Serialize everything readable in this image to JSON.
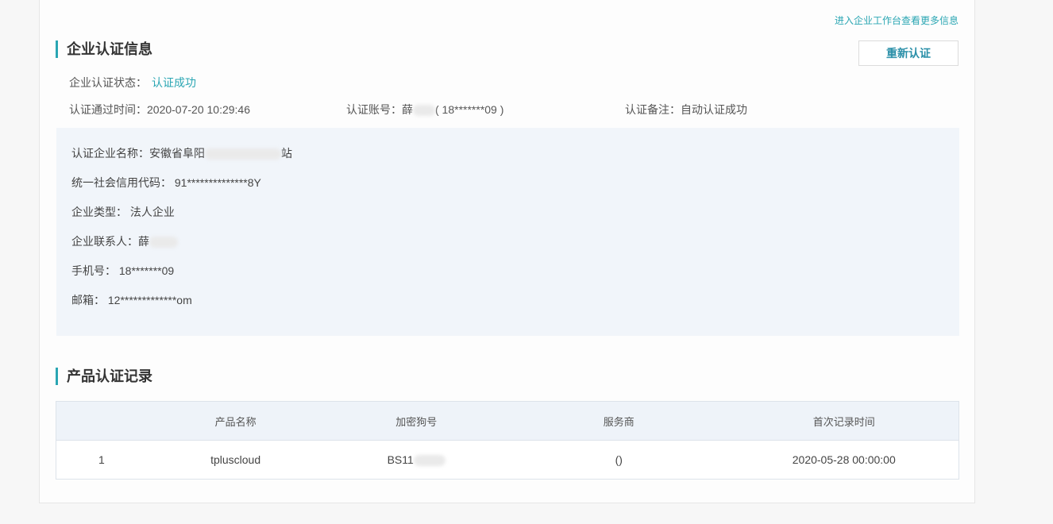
{
  "top_link": "进入企业工作台查看更多信息",
  "enterprise_section": {
    "title": "企业认证信息",
    "reauth_button": "重新认证",
    "status_label": "企业认证状态：",
    "status_value": "认证成功",
    "pass_time_label": "认证通过时间：",
    "pass_time_value": "2020-07-20 10:29:46",
    "account_label": "认证账号：",
    "account_value_prefix": "薛",
    "account_value_suffix": "( 18*******09 )",
    "remark_label": "认证备注：",
    "remark_value": "自动认证成功"
  },
  "details": {
    "company_name_label": "认证企业名称：",
    "company_name_prefix": "安徽省阜阳",
    "company_name_suffix": "站",
    "credit_code_label": "统一社会信用代码：",
    "credit_code_value": "91**************8Y",
    "type_label": "企业类型：",
    "type_value": "法人企业",
    "contact_label": "企业联系人：",
    "contact_value_prefix": "薛",
    "phone_label": "手机号：",
    "phone_value": "18*******09",
    "email_label": "邮箱：",
    "email_value": "12*************om"
  },
  "product_section": {
    "title": "产品认证记录",
    "columns": [
      "",
      "产品名称",
      "加密狗号",
      "服务商",
      "首次记录时间"
    ],
    "rows": [
      {
        "index": "1",
        "product_name": "tpluscloud",
        "dongle_prefix": "BS11",
        "provider": "()",
        "first_time": "2020-05-28 00:00:00"
      }
    ]
  }
}
